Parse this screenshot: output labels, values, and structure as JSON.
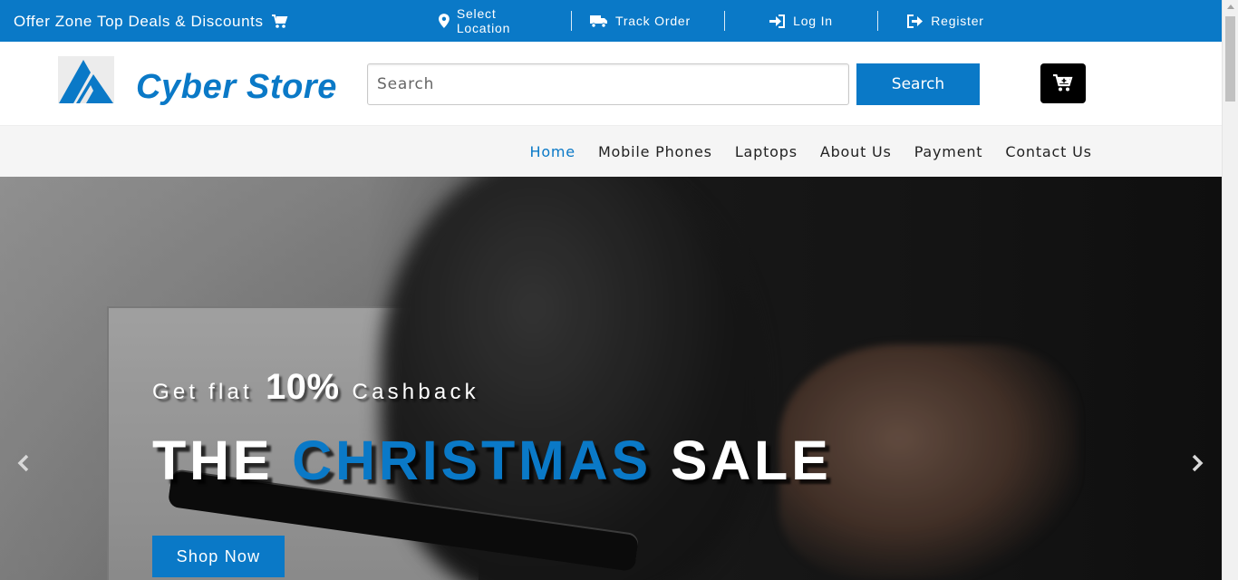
{
  "topbar": {
    "offer_text": "Offer Zone Top Deals & Discounts",
    "offer_icon": "cart-icon",
    "links": [
      {
        "label": "Select Location",
        "icon": "map-marker-icon"
      },
      {
        "label": "Track Order",
        "icon": "truck-icon"
      },
      {
        "label": "Log In",
        "icon": "sign-in-icon"
      },
      {
        "label": "Register",
        "icon": "sign-out-icon"
      }
    ]
  },
  "header": {
    "brand": "Cyber Store",
    "search_placeholder": "Search",
    "search_button": "Search",
    "cart_icon": "cart-plus-icon"
  },
  "nav": {
    "items": [
      "Home",
      "Mobile Phones",
      "Laptops",
      "About Us",
      "Payment",
      "Contact Us"
    ],
    "active": "Home"
  },
  "hero": {
    "sub_prefix": "Get flat",
    "sub_percent": "10%",
    "sub_suffix": "Cashback",
    "title_part1": "THE",
    "title_highlight": "CHRISTMAS",
    "title_part2": "SALE",
    "cta": "Shop Now",
    "prev_icon": "chevron-left-icon",
    "next_icon": "chevron-right-icon"
  },
  "colors": {
    "brand_blue": "#0a79c7",
    "cart_button_bg": "#000000",
    "nav_bg": "#f5f5f5"
  }
}
